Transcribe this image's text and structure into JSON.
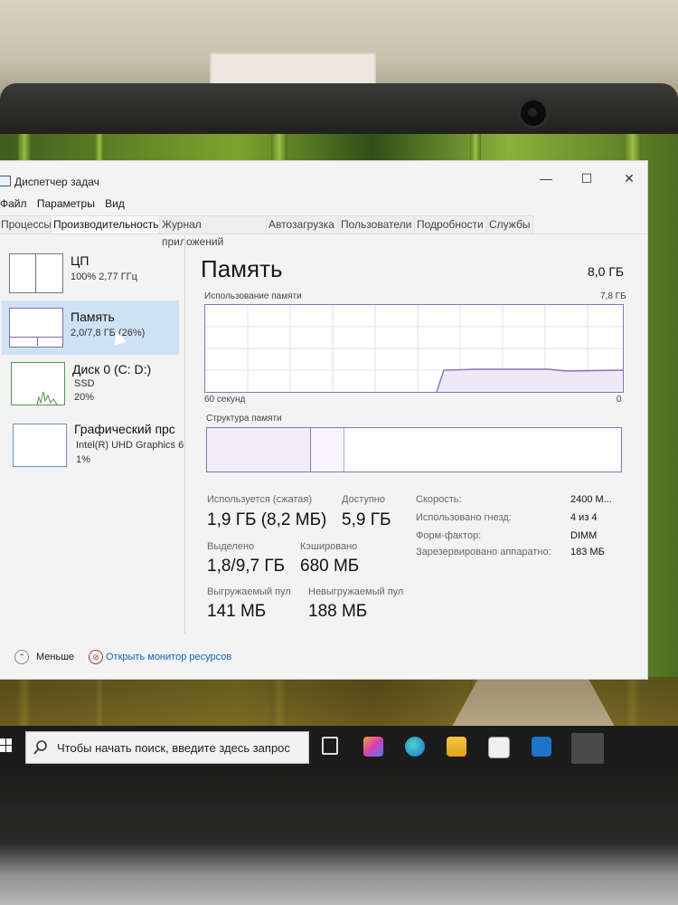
{
  "window": {
    "title": "Диспетчер задач",
    "controls": {
      "minimize": "—",
      "maximize": "☐",
      "close": "✕"
    }
  },
  "menu": [
    "Файл",
    "Параметры",
    "Вид"
  ],
  "tabs": [
    "Процессы",
    "Производительность",
    "Журнал приложений",
    "Автозагрузка",
    "Пользователи",
    "Подробности",
    "Службы"
  ],
  "active_tab": "Производительность",
  "sidebar": {
    "items": [
      {
        "name": "ЦП",
        "line1": "100%  2,77 ГГц",
        "line2": ""
      },
      {
        "name": "Память",
        "line1": "2,0/7,8 ГБ (26%)",
        "line2": ""
      },
      {
        "name": "Диск 0 (C: D:)",
        "line1": "SSD",
        "line2": "20%"
      },
      {
        "name": "Графический прс",
        "line1": "Intel(R) UHD Graphics 6",
        "line2": "1%"
      }
    ],
    "selected": "Память"
  },
  "main": {
    "title": "Память",
    "total": "8,0 ГБ",
    "graph_label": "Использование памяти",
    "graph_max": "7,8 ГБ",
    "graph_time": "60 секунд",
    "graph_zero": "0",
    "structure_label": "Структура памяти"
  },
  "stats": {
    "in_use_label": "Используется (сжатая)",
    "in_use_value": "1,9 ГБ (8,2 МБ)",
    "available_label": "Доступно",
    "available_value": "5,9 ГБ",
    "committed_label": "Выделено",
    "committed_value": "1,8/9,7 ГБ",
    "cached_label": "Кэшировано",
    "cached_value": "680 МБ",
    "paged_label": "Выгружаемый пул",
    "paged_value": "141 МБ",
    "nonpaged_label": "Невыгружаемый пул",
    "nonpaged_value": "188 МБ"
  },
  "specs": [
    {
      "label": "Скорость:",
      "value": "2400 М..."
    },
    {
      "label": "Использовано гнезд:",
      "value": "4 из 4"
    },
    {
      "label": "Форм-фактор:",
      "value": "DIMM"
    },
    {
      "label": "Зарезервировано аппаратно:",
      "value": "183 МБ"
    }
  ],
  "footer": {
    "less": "Меньше",
    "resource_monitor": "Открыть монитор ресурсов"
  },
  "taskbar": {
    "search_placeholder": "Чтобы начать поиск, введите здесь запрос"
  },
  "colors": {
    "memory_accent": "#8a72b5",
    "selection": "#cde2f5",
    "link": "#1a5fb4",
    "disk_accent": "#4a9a47"
  }
}
